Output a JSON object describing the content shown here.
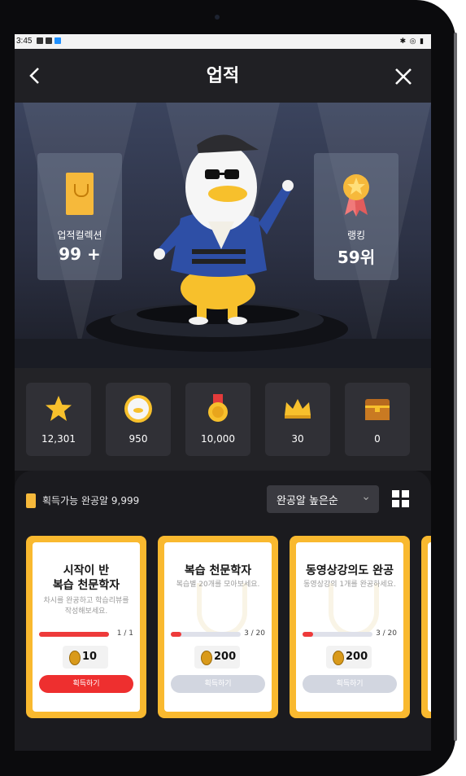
{
  "status": {
    "time": "3:45",
    "right": "✱ ◎ ▮"
  },
  "header": {
    "title": "업적",
    "back": "‹",
    "close": "✕"
  },
  "hero": {
    "collection": {
      "label": "업적컬렉션",
      "value": "99 +"
    },
    "ranking": {
      "label": "랭킹",
      "value": "59위"
    }
  },
  "stats": [
    {
      "icon": "star-icon",
      "value": "12,301"
    },
    {
      "icon": "character-coin-icon",
      "value": "950"
    },
    {
      "icon": "medal-icon",
      "value": "10,000"
    },
    {
      "icon": "crown-icon",
      "value": "30"
    },
    {
      "icon": "treasure-chest-icon",
      "value": "0"
    }
  ],
  "list": {
    "available": "획득가능 완공알 9,999",
    "sort_label": "완공알 높은순",
    "sort_chevron": "⌄"
  },
  "cards": [
    {
      "title": "시작이 반\n복습 천문학자",
      "desc": "차시를 완공하고 학습리뷰를\n작성해보세요.",
      "progress_text": "1 / 1",
      "progress": 1.0,
      "reward": "10",
      "button": "획득하기",
      "state": "active"
    },
    {
      "title": "복습 천문학자",
      "desc": "복습별 20개를 모아보세요.",
      "progress_text": "3 / 20",
      "progress": 0.15,
      "reward": "200",
      "button": "획득하기",
      "state": "off"
    },
    {
      "title": "동영상강의도 완공",
      "desc": "동영상강의 1개를 완공하세요.",
      "progress_text": "3 / 20",
      "progress": 0.15,
      "reward": "200",
      "button": "획득하기",
      "state": "off"
    }
  ],
  "colors": {
    "accent": "#f9b92f",
    "danger": "#ee2f2f",
    "bg": "#141417"
  }
}
